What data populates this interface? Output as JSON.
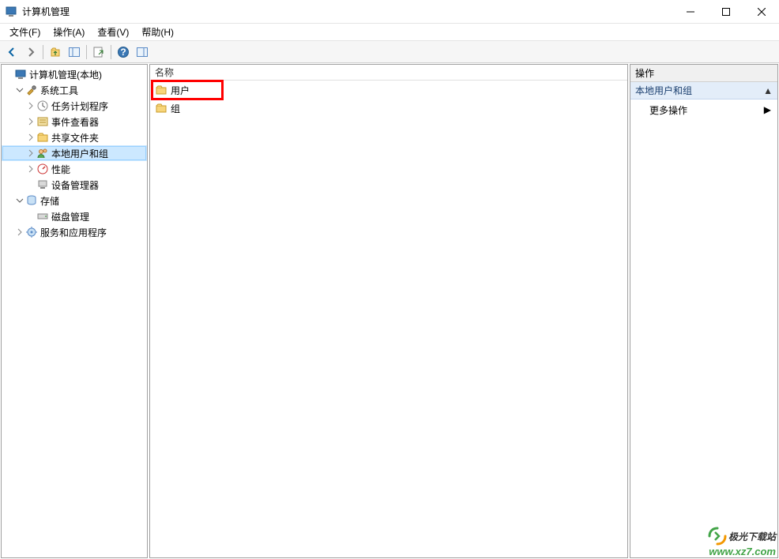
{
  "window": {
    "title": "计算机管理"
  },
  "menubar": {
    "file": "文件(F)",
    "action": "操作(A)",
    "view": "查看(V)",
    "help": "帮助(H)"
  },
  "tree": {
    "root": "计算机管理(本地)",
    "system_tools": "系统工具",
    "task_scheduler": "任务计划程序",
    "event_viewer": "事件查看器",
    "shared_folders": "共享文件夹",
    "local_users_groups": "本地用户和组",
    "performance": "性能",
    "device_manager": "设备管理器",
    "storage": "存储",
    "disk_management": "磁盘管理",
    "services_apps": "服务和应用程序"
  },
  "list": {
    "column_name": "名称",
    "items": [
      {
        "label": "用户"
      },
      {
        "label": "组"
      }
    ]
  },
  "actions": {
    "header": "操作",
    "section": "本地用户和组",
    "more": "更多操作"
  },
  "watermark": {
    "brand_cn": "极光下载站",
    "url": "www.xz7.com"
  }
}
